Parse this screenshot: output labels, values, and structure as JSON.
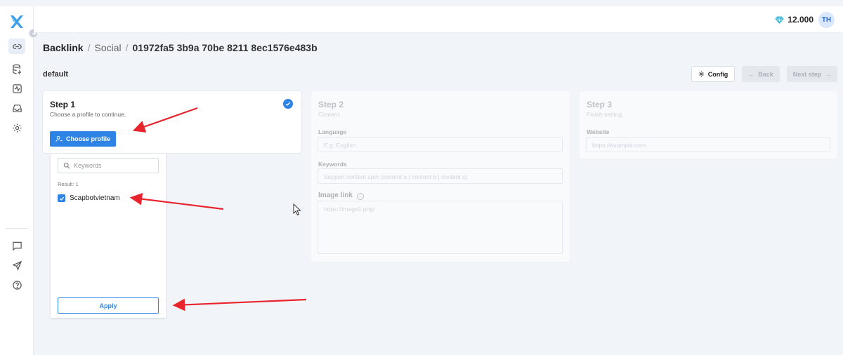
{
  "topbar": {
    "credits": "12.000",
    "avatar_initials": "TH"
  },
  "breadcrumb": {
    "root": "Backlink",
    "section": "Social",
    "id": "01972fa5 3b9a 70be 8211 8ec1576e483b",
    "separator": "/"
  },
  "project": {
    "name": "default"
  },
  "actions": {
    "config": "Config",
    "back": "Back",
    "next": "Next step"
  },
  "steps": {
    "step1": {
      "title": "Step 1",
      "subtitle": "Choose a profile to continue.",
      "button": "Choose profile"
    },
    "step2": {
      "title": "Step 2",
      "subtitle": "Content.",
      "language_label": "Language",
      "language_placeholder": "E.g: English",
      "keywords_label": "Keywords",
      "keywords_placeholder": "Support content spin {content a | content b | content c}",
      "image_label": "Image link",
      "image_placeholder": "https://image1.png/"
    },
    "step3": {
      "title": "Step 3",
      "subtitle": "Finish setting.",
      "website_label": "Website",
      "website_placeholder": "https://example.com"
    }
  },
  "dropdown": {
    "search_placeholder": "Keywords",
    "result_label": "Result: 1",
    "items": [
      {
        "label": "Scapbotvietnam",
        "checked": true
      }
    ],
    "apply": "Apply"
  },
  "colors": {
    "primary": "#2d84e5",
    "annotation": "#e8242c",
    "diamond": "#2bb3d8"
  },
  "sidebar": {
    "icons": [
      "link-icon",
      "database-icon",
      "activity-icon",
      "inbox-icon",
      "gear-icon",
      "chat-icon",
      "send-icon",
      "help-icon"
    ]
  }
}
